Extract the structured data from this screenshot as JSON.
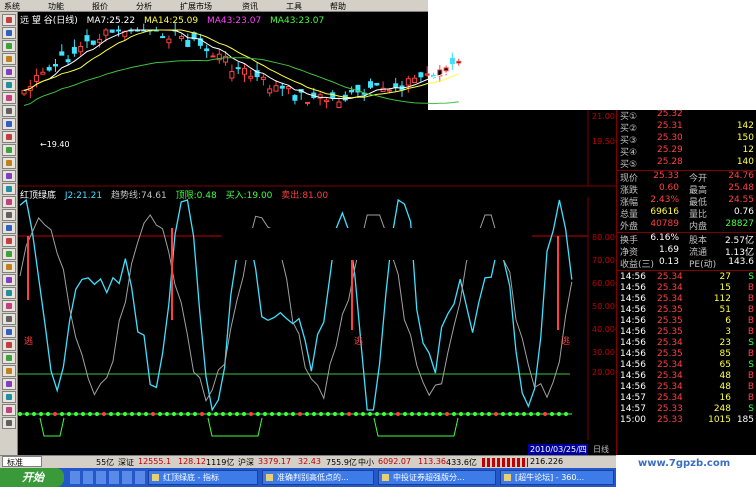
{
  "menubar": {
    "items": [
      "系统",
      "功能",
      "报价",
      "分析",
      "扩展市场",
      "资讯",
      "工具",
      "帮助"
    ]
  },
  "toolbar": {
    "colors": [
      "#c04040",
      "#3060c0",
      "#40a040",
      "#c08020",
      "#8040c0",
      "#2090a0",
      "#c04080",
      "#606060",
      "#3060c0",
      "#c04040",
      "#40a040",
      "#c08020",
      "#8040c0",
      "#2090a0",
      "#c04080",
      "#606060",
      "#3060c0",
      "#c04040",
      "#40a040",
      "#c08020",
      "#8040c0",
      "#2090a0",
      "#c04080",
      "#606060",
      "#3060c0",
      "#c04040",
      "#40a040",
      "#c08020",
      "#8040c0",
      "#2090a0",
      "#c04080",
      "#606060"
    ]
  },
  "price_chart": {
    "title": "远 望 谷(日线)",
    "ma7": "MA7:25.22",
    "ma14": "MA14:25.09",
    "ma43a": "MA43:23.07",
    "ma43b": "MA43:23.07",
    "low_marker": "←19.40",
    "y_labels": [
      "21.00",
      "19.50"
    ]
  },
  "indicator": {
    "name": "红顶绿底",
    "j": "J2:21.21",
    "trend": "趋势线:74.61",
    "top": "顶限:0.48",
    "buy": "买入:19.00",
    "sell": "卖出:81.00",
    "y_labels": [
      "80.00",
      "70.00",
      "60.00",
      "50.00",
      "40.00",
      "30.00",
      "20.00"
    ],
    "marker": "逃",
    "date": "2010/03/25/四",
    "period": "日线"
  },
  "quote": {
    "bids": [
      {
        "label": "买①",
        "price": "25.32",
        "vol": ""
      },
      {
        "label": "买②",
        "price": "25.31",
        "vol": "142"
      },
      {
        "label": "买③",
        "price": "25.30",
        "vol": "150"
      },
      {
        "label": "买④",
        "price": "25.29",
        "vol": "12"
      },
      {
        "label": "买⑤",
        "price": "25.28",
        "vol": "140"
      }
    ],
    "stats": [
      {
        "l1": "现价",
        "v1": "25.33",
        "l2": "今开",
        "v2": "24.76",
        "c1": "#ff4040",
        "c2": "#ff4040"
      },
      {
        "l1": "涨跌",
        "v1": "0.60",
        "l2": "最高",
        "v2": "25.48",
        "c1": "#ff4040",
        "c2": "#ff4040"
      },
      {
        "l1": "涨幅",
        "v1": "2.43%",
        "l2": "最低",
        "v2": "24.55",
        "c1": "#ff4040",
        "c2": "#ff4040"
      },
      {
        "l1": "总量",
        "v1": "69616",
        "l2": "量比",
        "v2": "0.76",
        "c1": "#ffff40",
        "c2": "#ffffff"
      },
      {
        "l1": "外盘",
        "v1": "40789",
        "l2": "内盘",
        "v2": "28827",
        "c1": "#ff4040",
        "c2": "#40ff40"
      }
    ],
    "extra": [
      {
        "l1": "换手",
        "v1": "6.16%",
        "l2": "股本",
        "v2": "2.57亿"
      },
      {
        "l1": "净资",
        "v1": "1.69",
        "l2": "流通",
        "v2": "1.13亿"
      },
      {
        "l1": "收益(三)",
        "v1": "0.13",
        "l2": "PE(动)",
        "v2": "143.6"
      }
    ],
    "ticks": [
      {
        "t": "14:56",
        "p": "25.34",
        "v": "27",
        "d": "S"
      },
      {
        "t": "14:56",
        "p": "25.34",
        "v": "15",
        "d": "B"
      },
      {
        "t": "14:56",
        "p": "25.34",
        "v": "112",
        "d": "B"
      },
      {
        "t": "14:56",
        "p": "25.35",
        "v": "51",
        "d": "B"
      },
      {
        "t": "14:56",
        "p": "25.35",
        "v": "6",
        "d": "B"
      },
      {
        "t": "14:56",
        "p": "25.35",
        "v": "3",
        "d": "B"
      },
      {
        "t": "14:56",
        "p": "25.34",
        "v": "23",
        "d": "S"
      },
      {
        "t": "14:56",
        "p": "25.35",
        "v": "85",
        "d": "B"
      },
      {
        "t": "14:56",
        "p": "25.34",
        "v": "65",
        "d": "S"
      },
      {
        "t": "14:56",
        "p": "25.34",
        "v": "48",
        "d": "B"
      },
      {
        "t": "14:56",
        "p": "25.34",
        "v": "48",
        "d": "B"
      },
      {
        "t": "14:57",
        "p": "25.34",
        "v": "16",
        "d": "B"
      },
      {
        "t": "14:57",
        "p": "25.33",
        "v": "248",
        "d": "S"
      },
      {
        "t": "15:00",
        "p": "25.33",
        "v": "1015",
        "d": "185"
      }
    ]
  },
  "bottom_bar": {
    "tab": "标准",
    "amt1": "55亿",
    "idx1_name": "深证",
    "idx1_val": "12555.1",
    "idx1_chg": "128.12",
    "idx1_amt": "1119亿",
    "idx2_name": "沪深",
    "idx2_val": "3379.17",
    "idx2_chg": "32.43",
    "idx2_amt": "755.9亿",
    "idx3_name": "中小",
    "idx3_val": "6092.07",
    "idx3_chg": "113.36",
    "idx3_amt": "433.6亿",
    "right": "216.226"
  },
  "taskbar": {
    "start": "开始",
    "tasks": [
      "红顶绿底 - 指标",
      "准确判别高低点的...",
      "中投证券超强版分...",
      "[超牛论坛] - 360..."
    ]
  },
  "watermark": "www.7gpzb.com"
}
